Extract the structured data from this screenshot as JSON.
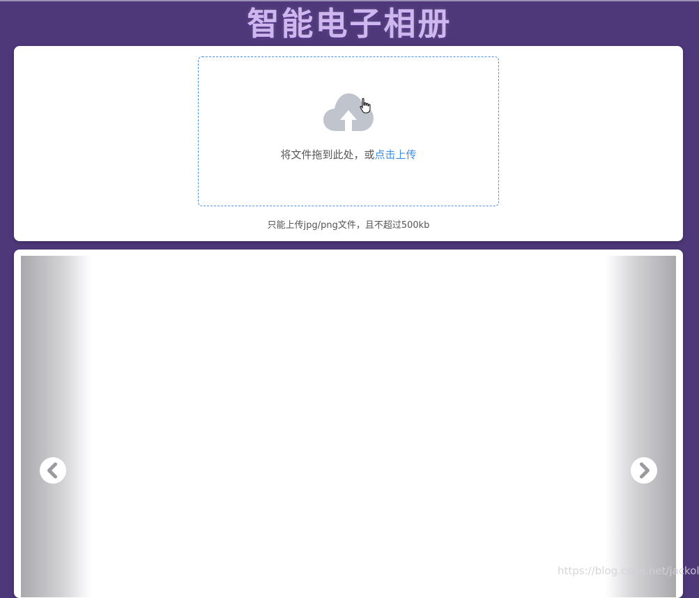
{
  "app": {
    "title": "智能电子相册"
  },
  "upload": {
    "drop_text": "将文件拖到此处，或",
    "link_text": "点击上传",
    "tip": "只能上传jpg/png文件，且不超过500kb",
    "icon": "upload-cloud-icon"
  },
  "gallery": {
    "prev_icon": "chevron-left-icon",
    "next_icon": "chevron-right-icon"
  },
  "watermark": "https://blog.csdn.net/jackols",
  "colors": {
    "background": "#4e3879",
    "title": "#cdb7ee",
    "link": "#3a8ee6",
    "dropzone_border": "#4a8fe0",
    "icon_gray": "#c0c4cc"
  }
}
